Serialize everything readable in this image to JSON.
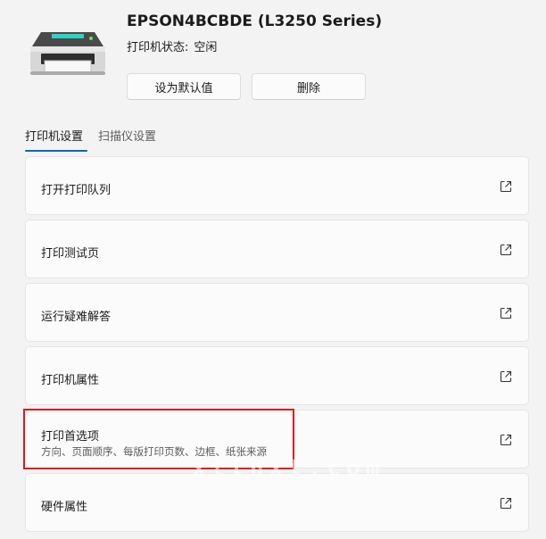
{
  "printer": {
    "name": "EPSON4BCBDE (L3250 Series)",
    "status_label": "打印机状态:",
    "status_value": "空闲"
  },
  "actions": {
    "set_default": "设为默认值",
    "remove": "删除"
  },
  "tabs": [
    {
      "label": "打印机设置",
      "active": true
    },
    {
      "label": "扫描仪设置",
      "active": false
    }
  ],
  "settings": [
    {
      "label": "打开打印队列",
      "description": ""
    },
    {
      "label": "打印测试页",
      "description": ""
    },
    {
      "label": "运行疑难解答",
      "description": ""
    },
    {
      "label": "打印机属性",
      "description": ""
    },
    {
      "label": "打印首选项",
      "description": "方向、页面顺序、每版打印页数、边框、纸张来源"
    },
    {
      "label": "硬件属性",
      "description": ""
    }
  ],
  "colors": {
    "accent": "#0067c0",
    "highlight": "#e0191d"
  },
  "watermark": "xtlnxt.com"
}
